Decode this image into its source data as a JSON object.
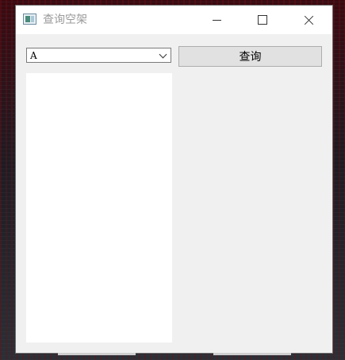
{
  "window": {
    "title": "查询空架",
    "icon": "app-window-icon"
  },
  "titlebar_buttons": {
    "minimize_icon": "minimize-icon",
    "maximize_icon": "maximize-icon",
    "close_icon": "close-icon"
  },
  "controls": {
    "combo_value": "A",
    "query_label": "查询"
  },
  "list": {
    "items": []
  }
}
